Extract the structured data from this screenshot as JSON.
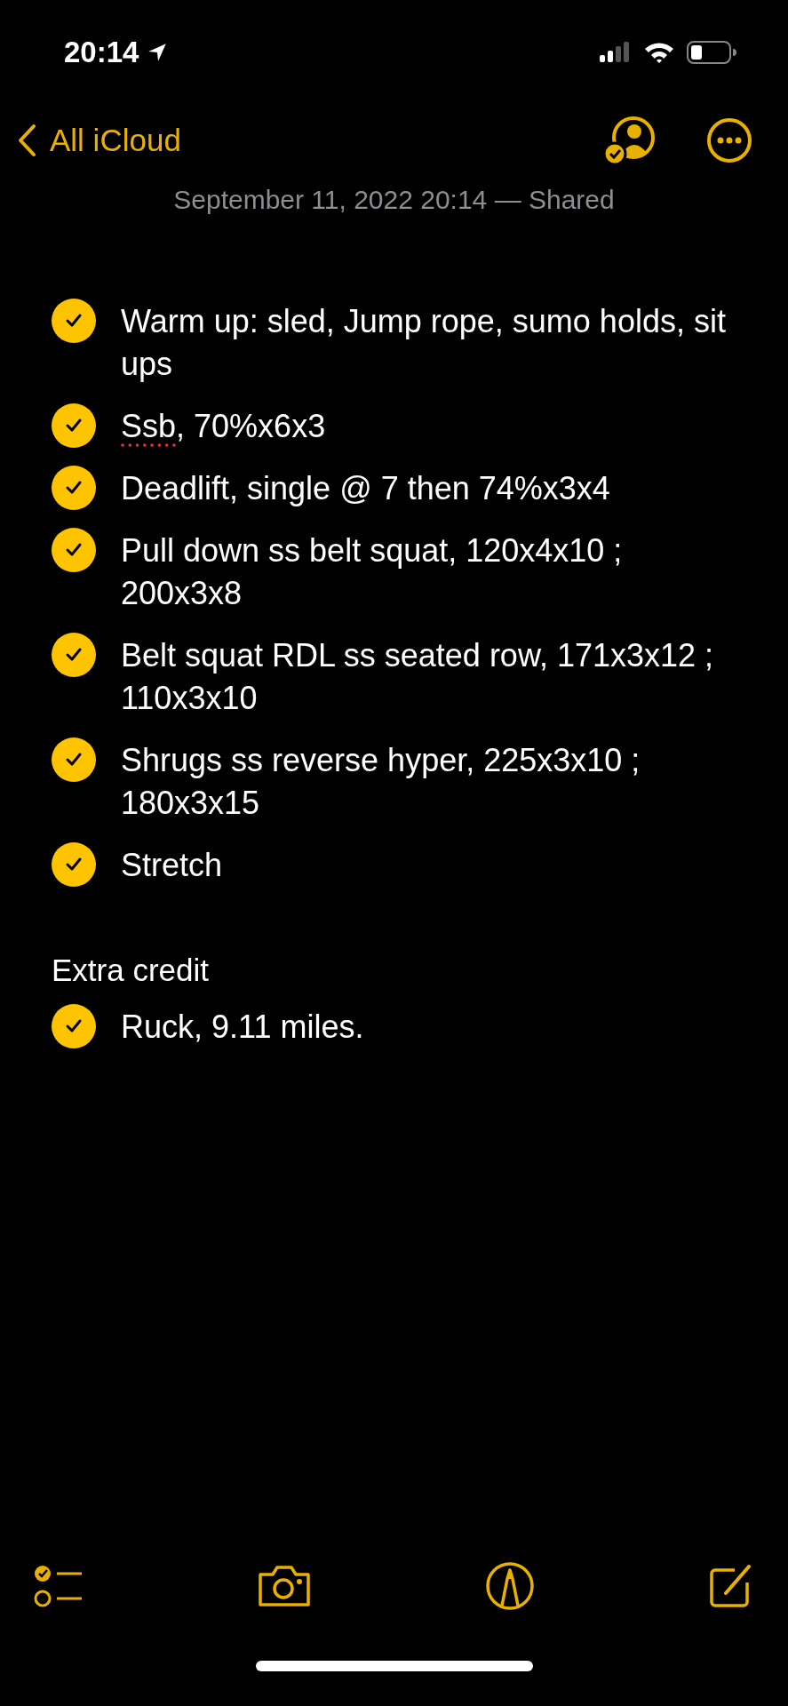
{
  "status_bar": {
    "time": "20:14"
  },
  "nav": {
    "back_label": "All iCloud"
  },
  "note": {
    "meta": "September 11, 2022 20:14 — Shared",
    "blocks": [
      {
        "kind": "checklist",
        "items": [
          {
            "text": "Warm up: sled, Jump rope, sumo holds, sit ups",
            "checked": true
          },
          {
            "parts": [
              {
                "text": "Ssb",
                "misspelled": true
              },
              {
                "text": ", 70%x6x3",
                "misspelled": false
              }
            ],
            "checked": true
          },
          {
            "text": "Deadlift, single @ 7 then 74%x3x4",
            "checked": true
          },
          {
            "text": "Pull down ss belt squat, 120x4x10 ; 200x3x8",
            "checked": true
          },
          {
            "text": "Belt squat RDL ss seated row, 171x3x12 ; 110x3x10",
            "checked": true
          },
          {
            "text": "Shrugs ss reverse hyper, 225x3x10 ; 180x3x15",
            "checked": true
          },
          {
            "text": "Stretch",
            "checked": true
          }
        ]
      },
      {
        "kind": "paragraph",
        "text": "Extra credit"
      },
      {
        "kind": "checklist",
        "items": [
          {
            "text": "Ruck, 9.11 miles.",
            "checked": true
          }
        ]
      }
    ]
  }
}
